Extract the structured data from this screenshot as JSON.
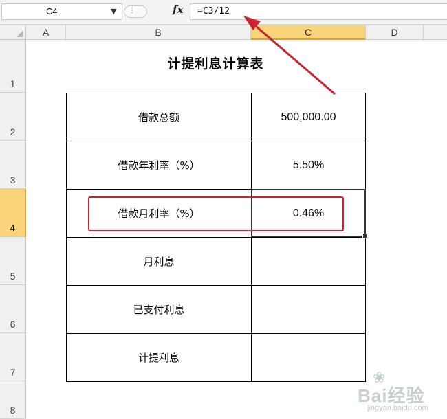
{
  "formula_bar": {
    "name_box": "C4",
    "fx_icon": "fx-icon",
    "formula": "=C3/12"
  },
  "columns": [
    "A",
    "B",
    "C",
    "D"
  ],
  "selected_column": "C",
  "rows": [
    "1",
    "2",
    "3",
    "4",
    "5",
    "6",
    "7",
    "8"
  ],
  "selected_row": "4",
  "sheet": {
    "title": "计提利息计算表",
    "table": [
      {
        "label": "借款总额",
        "value": "500,000.00"
      },
      {
        "label": "借款年利率（%）",
        "value": "5.50%"
      },
      {
        "label": "借款月利率（%）",
        "value": "0.46%"
      },
      {
        "label": "月利息",
        "value": ""
      },
      {
        "label": "已支付利息",
        "value": ""
      },
      {
        "label": "计提利息",
        "value": ""
      }
    ]
  },
  "annotation_color": "#cc2233",
  "watermark": {
    "logo": "Bai经验",
    "url": "jingyan.baidu.com"
  }
}
